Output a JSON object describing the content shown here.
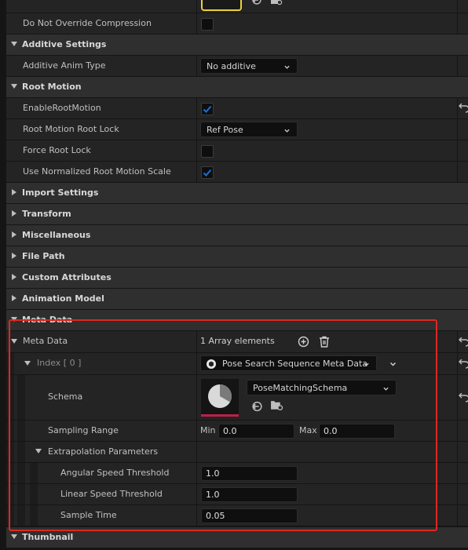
{
  "rows": {
    "compression_label": "Do Not Override Compression",
    "additive_section": "Additive Settings",
    "additive_anim_type_label": "Additive Anim Type",
    "additive_anim_type_value": "No additive",
    "root_motion_section": "Root Motion",
    "enable_root_motion_label": "EnableRootMotion",
    "root_lock_label": "Root Motion Root Lock",
    "root_lock_value": "Ref Pose",
    "force_root_lock_label": "Force Root Lock",
    "normalized_scale_label": "Use Normalized Root Motion Scale",
    "import_settings": "Import Settings",
    "transform": "Transform",
    "miscellaneous": "Miscellaneous",
    "file_path": "File Path",
    "custom_attributes": "Custom Attributes",
    "animation_model": "Animation Model",
    "meta_data_section": "Meta Data",
    "meta_data_label": "Meta Data",
    "array_elements": "1 Array elements",
    "index_label": "Index",
    "index_value": "[ 0 ]",
    "meta_class_value": "Pose Search Sequence Meta Data",
    "schema_label": "Schema",
    "schema_value": "PoseMatchingSchema",
    "sampling_range_label": "Sampling Range",
    "min_label": "Min",
    "min_value": "0.0",
    "max_label": "Max",
    "max_value": "0.0",
    "extrapolation_label": "Extrapolation Parameters",
    "angular_label": "Angular Speed Threshold",
    "angular_value": "1.0",
    "linear_label": "Linear Speed Threshold",
    "linear_value": "1.0",
    "sample_time_label": "Sample Time",
    "sample_time_value": "0.05",
    "thumbnail": "Thumbnail"
  },
  "checkboxes": {
    "do_not_override_compression": false,
    "enable_root_motion": true,
    "force_root_lock": false,
    "use_normalized_root_motion_scale": true
  },
  "icons": [
    "use-selected-icon",
    "browse-icon",
    "reset-arrow-icon",
    "add-element-icon",
    "delete-icon",
    "chevron-down-icon",
    "class-icon",
    "asset-thumbnail-icon"
  ],
  "colors": {
    "accent_blue": "#1a6fd6",
    "highlight_red": "#e0281f",
    "thumbnail_underline": "#c01f4a",
    "swatch_yellow": "#e8d23a"
  }
}
